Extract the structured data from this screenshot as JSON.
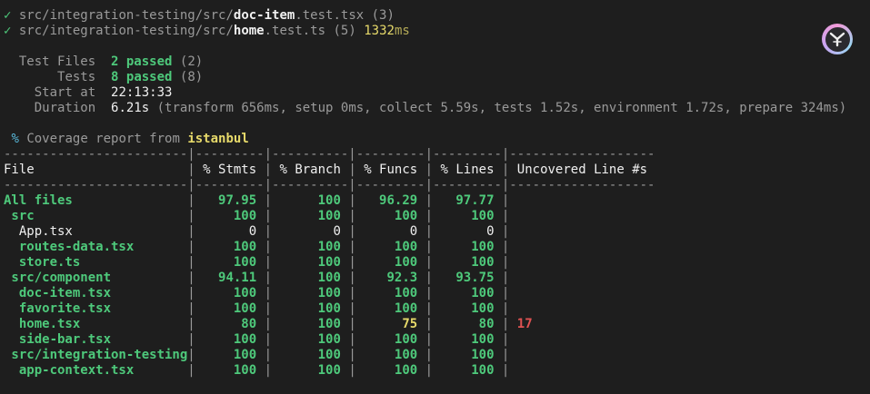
{
  "header": {
    "check": "✓",
    "test_files_list": [
      {
        "dir": "src/integration-testing/src/",
        "name": "doc-item",
        "ext": ".test.tsx",
        "count": "(3)",
        "duration": ""
      },
      {
        "dir": "src/integration-testing/src/",
        "name": "home",
        "ext": ".test.ts",
        "count": "(5)",
        "duration": "1332",
        "duration_unit": "ms"
      }
    ]
  },
  "summary": {
    "test_files_label": "Test Files",
    "test_files_passed": "2 passed",
    "test_files_total": "(2)",
    "tests_label": "Tests",
    "tests_passed": "8 passed",
    "tests_total": "(8)",
    "start_label": "Start at",
    "start_value": "22:13:33",
    "duration_label": "Duration",
    "duration_value": "6.21s",
    "duration_detail": "(transform 656ms, setup 0ms, collect 5.59s, tests 1.52s, environment 1.72s, prepare 324ms)"
  },
  "coverage": {
    "prefix": "%",
    "title": "Coverage report from",
    "provider": "istanbul",
    "columns": [
      "File",
      "% Stmts",
      "% Branch",
      "% Funcs",
      "% Lines",
      "Uncovered Line #s"
    ],
    "rows": [
      {
        "file": "All files",
        "stmts": "97.95",
        "branch": "100",
        "funcs": "96.29",
        "lines": "97.77",
        "uncovered": "",
        "indent": 0,
        "level": "high",
        "funcs_level": "high"
      },
      {
        "file": "src",
        "stmts": "100",
        "branch": "100",
        "funcs": "100",
        "lines": "100",
        "uncovered": "",
        "indent": 1,
        "level": "high",
        "funcs_level": "high"
      },
      {
        "file": "App.tsx",
        "stmts": "0",
        "branch": "0",
        "funcs": "0",
        "lines": "0",
        "uncovered": "",
        "indent": 2,
        "level": "none",
        "funcs_level": "none"
      },
      {
        "file": "routes-data.tsx",
        "stmts": "100",
        "branch": "100",
        "funcs": "100",
        "lines": "100",
        "uncovered": "",
        "indent": 2,
        "level": "high",
        "funcs_level": "high"
      },
      {
        "file": "store.ts",
        "stmts": "100",
        "branch": "100",
        "funcs": "100",
        "lines": "100",
        "uncovered": "",
        "indent": 2,
        "level": "high",
        "funcs_level": "high"
      },
      {
        "file": "src/component",
        "stmts": "94.11",
        "branch": "100",
        "funcs": "92.3",
        "lines": "93.75",
        "uncovered": "",
        "indent": 1,
        "level": "high",
        "funcs_level": "high"
      },
      {
        "file": "doc-item.tsx",
        "stmts": "100",
        "branch": "100",
        "funcs": "100",
        "lines": "100",
        "uncovered": "",
        "indent": 2,
        "level": "high",
        "funcs_level": "high"
      },
      {
        "file": "favorite.tsx",
        "stmts": "100",
        "branch": "100",
        "funcs": "100",
        "lines": "100",
        "uncovered": "",
        "indent": 2,
        "level": "high",
        "funcs_level": "high"
      },
      {
        "file": "home.tsx",
        "stmts": "80",
        "branch": "100",
        "funcs": "75",
        "lines": "80",
        "uncovered": "17",
        "indent": 2,
        "level": "high",
        "funcs_level": "medium"
      },
      {
        "file": "side-bar.tsx",
        "stmts": "100",
        "branch": "100",
        "funcs": "100",
        "lines": "100",
        "uncovered": "",
        "indent": 2,
        "level": "high",
        "funcs_level": "high"
      },
      {
        "file": "src/integration-testing",
        "stmts": "100",
        "branch": "100",
        "funcs": "100",
        "lines": "100",
        "uncovered": "",
        "indent": 1,
        "level": "high",
        "funcs_level": "high"
      },
      {
        "file": "app-context.tsx",
        "stmts": "100",
        "branch": "100",
        "funcs": "100",
        "lines": "100",
        "uncovered": "",
        "indent": 2,
        "level": "high",
        "funcs_level": "high"
      }
    ]
  },
  "app_badge": {
    "icon": "vitest-logo-icon"
  },
  "colors": {
    "background": "#1e1e1e",
    "green": "#4ec97b",
    "yellow": "#e6d96a",
    "red": "#e05252",
    "cyan": "#58b7d8"
  }
}
